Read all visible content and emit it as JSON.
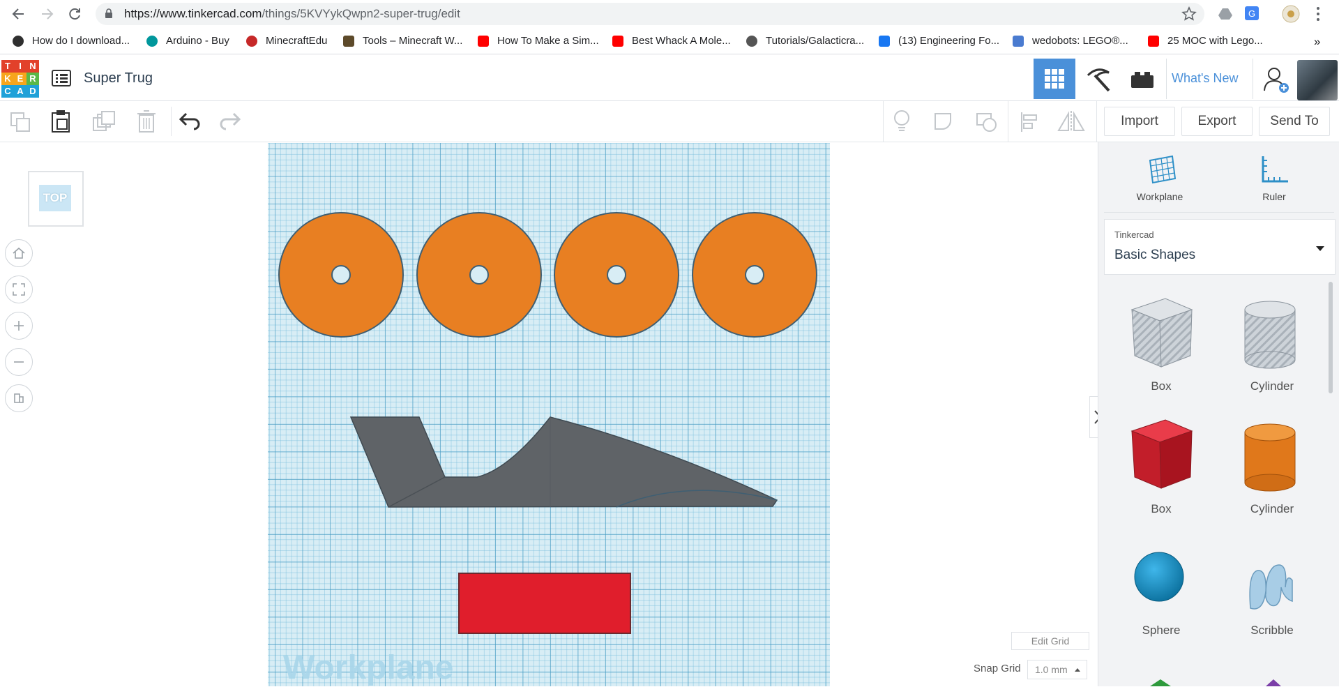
{
  "browser": {
    "url_host": "https://www.tinkercad.com",
    "url_path": "/things/5KVYykQwpn2-super-trug/edit",
    "bookmarks": [
      {
        "label": "How do I download...",
        "color": "#2f2f2f"
      },
      {
        "label": "Arduino - Buy",
        "color": "#00979c"
      },
      {
        "label": "MinecraftEdu",
        "color": "#c62828"
      },
      {
        "label": "Tools – Minecraft W...",
        "color": "#5d4a2a"
      },
      {
        "label": "How To Make a Sim...",
        "color": "#ff0000"
      },
      {
        "label": "Best Whack A Mole...",
        "color": "#ff0000"
      },
      {
        "label": "Tutorials/Galacticra...",
        "color": "#555555"
      },
      {
        "label": "(13) Engineering Fo...",
        "color": "#1877f2"
      },
      {
        "label": "wedobots: LEGO®...",
        "color": "#4a7bd0"
      },
      {
        "label": "25 MOC with Lego...",
        "color": "#ff0000"
      }
    ],
    "more": "»"
  },
  "app": {
    "logo": [
      "T",
      "I",
      "N",
      "K",
      "E",
      "R",
      "C",
      "A",
      "D"
    ],
    "design_title": "Super Trug",
    "whats_new": "What's New",
    "accent": "#4a90d9"
  },
  "toolbar": {
    "import": "Import",
    "export": "Export",
    "send_to": "Send To"
  },
  "view": {
    "cube_face": "TOP",
    "workplane_label": "Workplane",
    "edit_grid": "Edit Grid",
    "snap_grid_label": "Snap Grid",
    "snap_grid_value": "1.0 mm"
  },
  "panel": {
    "workplane": "Workplane",
    "ruler": "Ruler",
    "library_source": "Tinkercad",
    "library_name": "Basic Shapes",
    "shapes": [
      "Box",
      "Cylinder",
      "Box",
      "Cylinder",
      "Sphere",
      "Scribble"
    ]
  },
  "colors": {
    "wheel": "#e87f22",
    "body": "#5f6367",
    "red_box": "#e01e2c"
  }
}
